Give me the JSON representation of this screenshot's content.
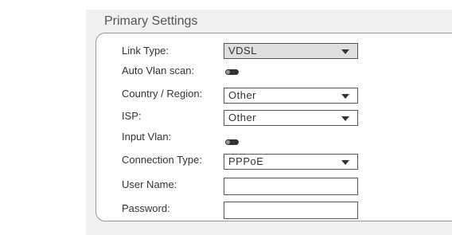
{
  "section": {
    "title": "Primary Settings"
  },
  "fields": {
    "link_type": {
      "label": "Link Type:",
      "value": "VDSL"
    },
    "auto_vlan_scan": {
      "label": "Auto Vlan scan:",
      "state": "off"
    },
    "country_region": {
      "label": "Country / Region:",
      "value": "Other"
    },
    "isp": {
      "label": "ISP:",
      "value": "Other"
    },
    "input_vlan": {
      "label": "Input Vlan:",
      "state": "off"
    },
    "connection_type": {
      "label": "Connection Type:",
      "value": "PPPoE"
    },
    "user_name": {
      "label": "User Name:",
      "value": ""
    },
    "password": {
      "label": "Password:",
      "value": ""
    }
  },
  "icons": {
    "dropdown": "chevron-down-icon"
  },
  "colors": {
    "panel_background": "#f0f0f0",
    "disabled_select": "#dedede",
    "text": "#333333",
    "border": "#555555"
  }
}
